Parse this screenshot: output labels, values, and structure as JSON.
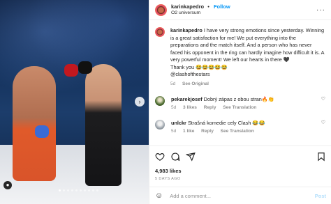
{
  "post": {
    "author": "karinkapedro",
    "follow_label": "Follow",
    "location": "O2 universum",
    "separator": "•",
    "more_glyph": "···",
    "caption": "I have very strong emotions since yesterday. Winning is a great satisfaction for me! We put everything into the preparations and the match itself. And a person who has never faced his opponent in the ring can hardly imagine how difficult it is. A very powerful moment! We left our hearts in there 🖤",
    "caption_thanks": "Thank you 😂😂😂😂😂",
    "caption_tag": "@clashofthestars",
    "caption_age": "5d",
    "see_original": "See Original",
    "likes": "4,983 likes",
    "time_ago": "5 DAYS AGO",
    "photo_dots": 10,
    "photo_active_dot": 1
  },
  "comments": [
    {
      "user": "pekarekjosef",
      "text": "Dobrý zápas z obou stran🔥👏",
      "age": "5d",
      "likes": "3 likes",
      "reply": "Reply",
      "translate": "See Translation"
    },
    {
      "user": "unlckr",
      "text": "Strašná komedie cely Clash 😂😂",
      "age": "5d",
      "likes": "1 like",
      "reply": "Reply",
      "translate": "See Translation"
    }
  ],
  "composer": {
    "placeholder": "Add a comment...",
    "post_label": "Post",
    "emoji_icon": "☺"
  },
  "icons": [
    "heart-icon",
    "comment-icon",
    "share-icon",
    "save-icon",
    "emoji-icon",
    "more-icon",
    "chevron-right-icon",
    "user-tag-icon"
  ],
  "colors": {
    "accent": "#0095f6",
    "text": "#262626",
    "muted": "#8e8e8e",
    "post_disabled": "#b2dffc"
  }
}
